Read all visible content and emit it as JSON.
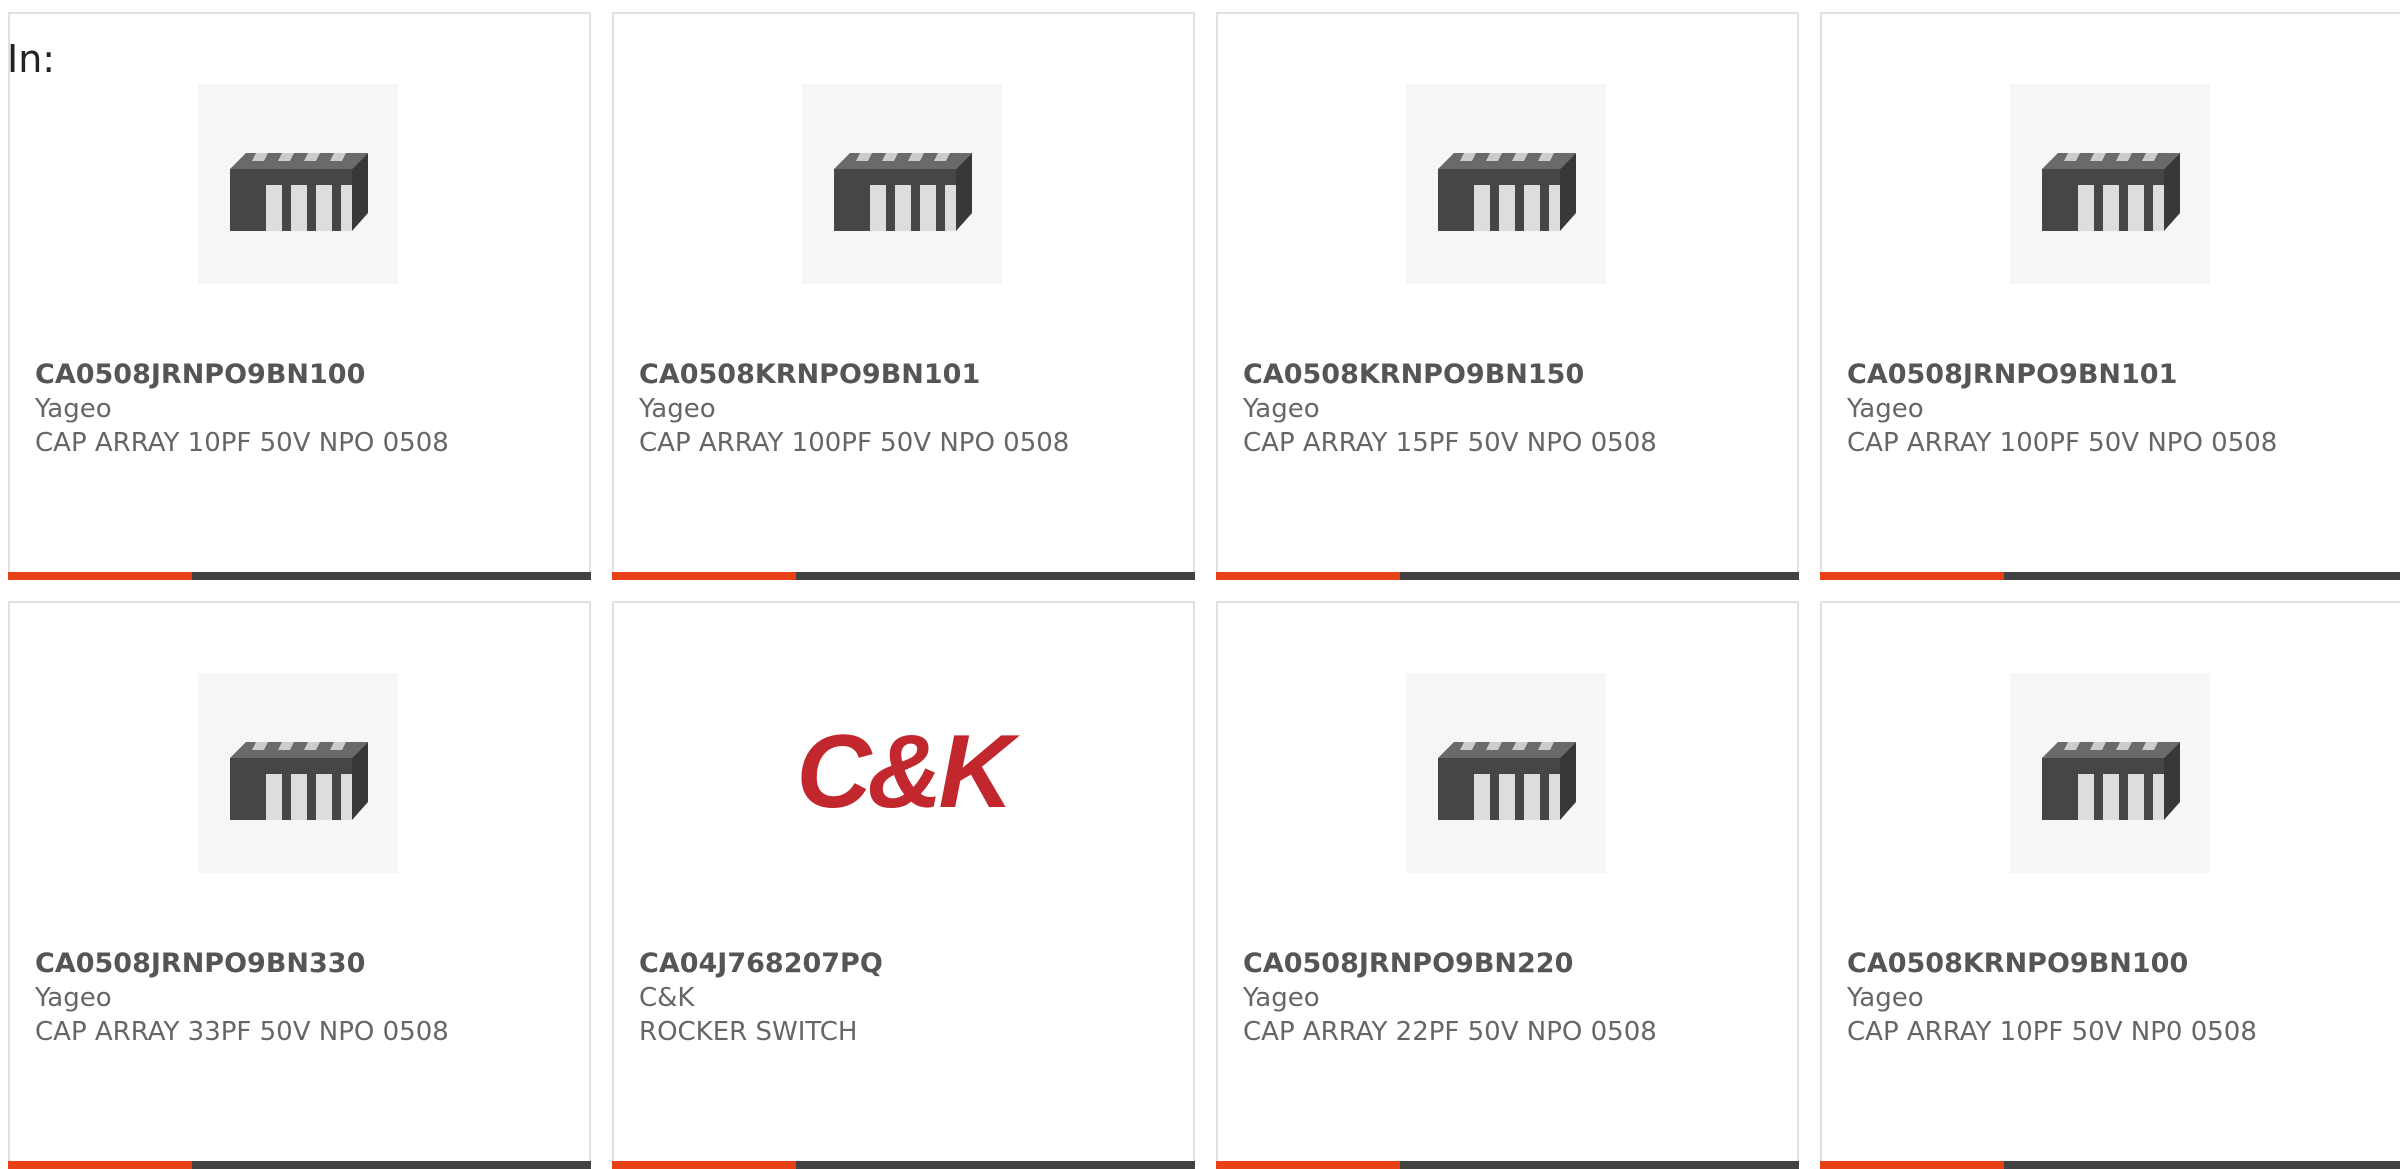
{
  "filter": {
    "label": "In:"
  },
  "colors": {
    "accent": "#e84118",
    "bar": "#424242",
    "card_border": "#e1e1e1"
  },
  "products": [
    {
      "part_number": "CA0508JRNPO9BN100",
      "manufacturer": "Yageo",
      "description": "CAP ARRAY 10PF 50V NPO 0508",
      "image": "capacitor-array-icon"
    },
    {
      "part_number": "CA0508KRNPO9BN101",
      "manufacturer": "Yageo",
      "description": "CAP ARRAY 100PF 50V NPO 0508",
      "image": "capacitor-array-icon"
    },
    {
      "part_number": "CA0508KRNPO9BN150",
      "manufacturer": "Yageo",
      "description": "CAP ARRAY 15PF 50V NPO 0508",
      "image": "capacitor-array-icon"
    },
    {
      "part_number": "CA0508JRNPO9BN101",
      "manufacturer": "Yageo",
      "description": "CAP ARRAY 100PF 50V NPO 0508",
      "image": "capacitor-array-icon"
    },
    {
      "part_number": "CA0508JRNPO9BN330",
      "manufacturer": "Yageo",
      "description": "CAP ARRAY 33PF 50V NPO 0508",
      "image": "capacitor-array-icon"
    },
    {
      "part_number": "CA04J768207PQ",
      "manufacturer": "C&K",
      "description": "ROCKER SWITCH",
      "image": "ck-logo",
      "logo_text": "C&K"
    },
    {
      "part_number": "CA0508JRNPO9BN220",
      "manufacturer": "Yageo",
      "description": "CAP ARRAY 22PF 50V NPO 0508",
      "image": "capacitor-array-icon"
    },
    {
      "part_number": "CA0508KRNPO9BN100",
      "manufacturer": "Yageo",
      "description": "CAP ARRAY 10PF 50V NP0 0508",
      "image": "capacitor-array-icon"
    }
  ]
}
